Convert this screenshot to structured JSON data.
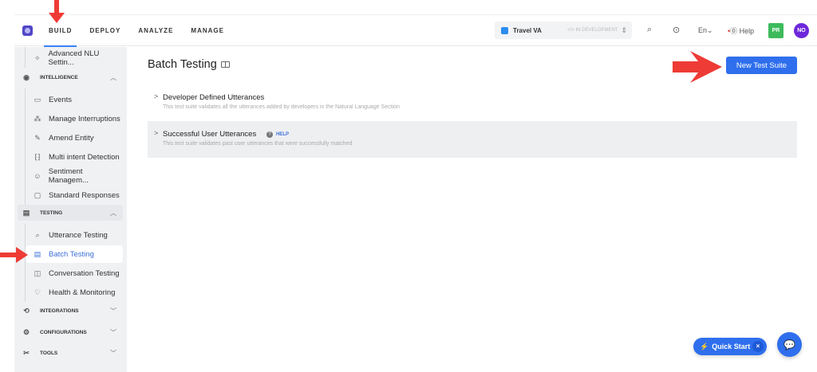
{
  "nav": {
    "tabs": [
      {
        "label": "BUILD",
        "active": true
      },
      {
        "label": "DEPLOY"
      },
      {
        "label": "ANALYZE"
      },
      {
        "label": "MANAGE"
      }
    ],
    "app_name": "Travel VA",
    "app_status": "IN DEVELOPMENT",
    "language": "En⌄",
    "help": "Help",
    "avatar_pr": "PR",
    "avatar_no": "NO",
    "avatar_pr_color": "#3dbb5c",
    "avatar_no_color": "#6d28d9"
  },
  "sidebar": {
    "top_item": "Advanced NLU Settin...",
    "intelligence": {
      "label": "INTELLIGENCE",
      "items": [
        "Events",
        "Manage Interruptions",
        "Amend Entity",
        "Multi intent Detection",
        "Sentiment Managem...",
        "Standard Responses"
      ]
    },
    "testing": {
      "label": "TESTING",
      "items": [
        "Utterance Testing",
        "Batch Testing",
        "Conversation Testing",
        "Health & Monitoring"
      ],
      "active": "Batch Testing"
    },
    "integrations": "INTEGRATIONS",
    "configurations": "CONFIGURATIONS",
    "tools": "TOOLS"
  },
  "main": {
    "title": "Batch Testing",
    "new_button": "New Test Suite",
    "suites": [
      {
        "name": "Developer Defined Utterances",
        "desc": "This test suite validates all the utterances added by developers in the Natural Language Section"
      },
      {
        "name": "Successful User Utterances",
        "desc": "This test suite validates past user utterances that were successfully matched",
        "help": "HELP"
      }
    ]
  },
  "quick_start": {
    "label": "Quick Start",
    "close": "×"
  },
  "accent": "#2f6fed",
  "annotation_color": "#ee3b35"
}
